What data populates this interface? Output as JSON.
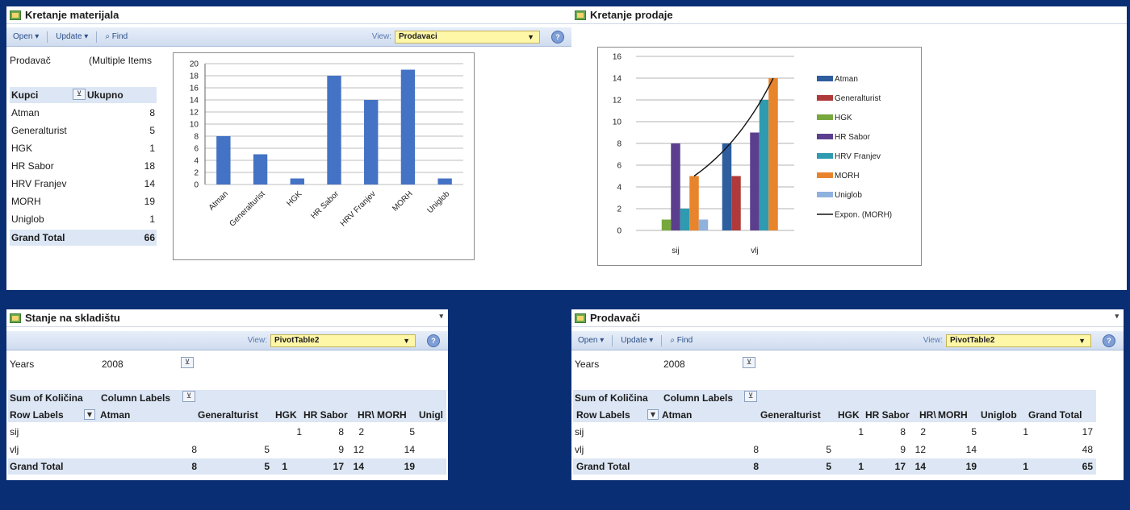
{
  "window_menu_glyph": "▾",
  "p1": {
    "title": "Kretanje materijala",
    "toolbar": {
      "open": "Open ▾",
      "update": "Update ▾",
      "find": "Find",
      "view_label": "View:",
      "view_value": "Prodavaci"
    },
    "filter_label": "Prodavač",
    "filter_value": "(Multiple Items",
    "col_row": "Kupci",
    "col_total": "Ukupno",
    "rows": [
      {
        "name": "Atman",
        "value": "8"
      },
      {
        "name": "Generalturist",
        "value": "5"
      },
      {
        "name": "HGK",
        "value": "1"
      },
      {
        "name": "HR Sabor",
        "value": "18"
      },
      {
        "name": "HRV Franjev",
        "value": "14"
      },
      {
        "name": "MORH",
        "value": "19"
      },
      {
        "name": "Uniglob",
        "value": "1"
      }
    ],
    "grand_total_label": "Grand Total",
    "grand_total_value": "66"
  },
  "p2": {
    "title": "Kretanje prodaje"
  },
  "p3": {
    "title": "Stanje na skladištu",
    "toolbar": {
      "view_label": "View:",
      "view_value": "PivotTable2"
    },
    "filter_label": "Years",
    "filter_value": "2008",
    "sum_label": "Sum of Količina",
    "col_labels": "Column Labels",
    "row_labels": "Row Labels",
    "headers": [
      "Atman",
      "Generalturist",
      "HGK",
      "HR Sabor",
      "HR\\",
      "MORH",
      "Unigl"
    ],
    "rows": [
      {
        "label": "sij",
        "cells": [
          "",
          "",
          "1",
          "8",
          "2",
          "5",
          ""
        ]
      },
      {
        "label": "vlj",
        "cells": [
          "8",
          "5",
          "",
          "9",
          "12",
          "14",
          ""
        ]
      }
    ],
    "grand": {
      "label": "Grand Total",
      "cells": [
        "8",
        "5",
        "1",
        "17",
        "14",
        "19",
        ""
      ]
    }
  },
  "p4": {
    "title": "Prodavači",
    "toolbar": {
      "open": "Open ▾",
      "update": "Update ▾",
      "find": "Find",
      "view_label": "View:",
      "view_value": "PivotTable2"
    },
    "filter_label": "Years",
    "filter_value": "2008",
    "sum_label": "Sum of Količina",
    "col_labels": "Column Labels",
    "row_labels": "Row Labels",
    "headers": [
      "Atman",
      "Generalturist",
      "HGK",
      "HR Sabor",
      "HR\\",
      "MORH",
      "Uniglob",
      "Grand Total"
    ],
    "rows": [
      {
        "label": "sij",
        "cells": [
          "",
          "",
          "1",
          "8",
          "2",
          "5",
          "1",
          "17"
        ]
      },
      {
        "label": "vlj",
        "cells": [
          "8",
          "5",
          "",
          "9",
          "12",
          "14",
          "",
          "48"
        ]
      }
    ],
    "grand": {
      "label": "Grand Total",
      "cells": [
        "8",
        "5",
        "1",
        "17",
        "14",
        "19",
        "1",
        "65"
      ]
    }
  },
  "chart_data": [
    {
      "type": "bar",
      "categories": [
        "Atman",
        "Generalturist",
        "HGK",
        "HR Sabor",
        "HRV Franjev",
        "MORH",
        "Uniglob"
      ],
      "values": [
        8,
        5,
        1,
        18,
        14,
        19,
        1
      ],
      "ylim": [
        0,
        20
      ],
      "y_ticks": [
        0,
        2,
        4,
        6,
        8,
        10,
        12,
        14,
        16,
        18,
        20
      ],
      "color": "#4472c4",
      "grid": true
    },
    {
      "type": "bar",
      "categories": [
        "sij",
        "vlj"
      ],
      "ylim": [
        0,
        16
      ],
      "y_ticks": [
        0,
        2,
        4,
        6,
        8,
        10,
        12,
        14,
        16
      ],
      "legend_position": "right",
      "series": [
        {
          "name": "Atman",
          "color": "#2e5e9e",
          "values": [
            0,
            8
          ]
        },
        {
          "name": "Generalturist",
          "color": "#b03a3a",
          "values": [
            0,
            5
          ]
        },
        {
          "name": "HGK",
          "color": "#77a83e",
          "values": [
            1,
            0
          ]
        },
        {
          "name": "HR Sabor",
          "color": "#5b3f8e",
          "values": [
            8,
            9
          ]
        },
        {
          "name": "HRV Franjev",
          "color": "#2f9bb0",
          "values": [
            2,
            12
          ]
        },
        {
          "name": "MORH",
          "color": "#e8842c",
          "values": [
            5,
            14
          ]
        },
        {
          "name": "Uniglob",
          "color": "#8fb1de",
          "values": [
            1,
            0
          ]
        }
      ],
      "trendline": {
        "name": "Expon. (MORH)",
        "color": "#111111",
        "values": [
          5,
          14
        ]
      }
    }
  ]
}
